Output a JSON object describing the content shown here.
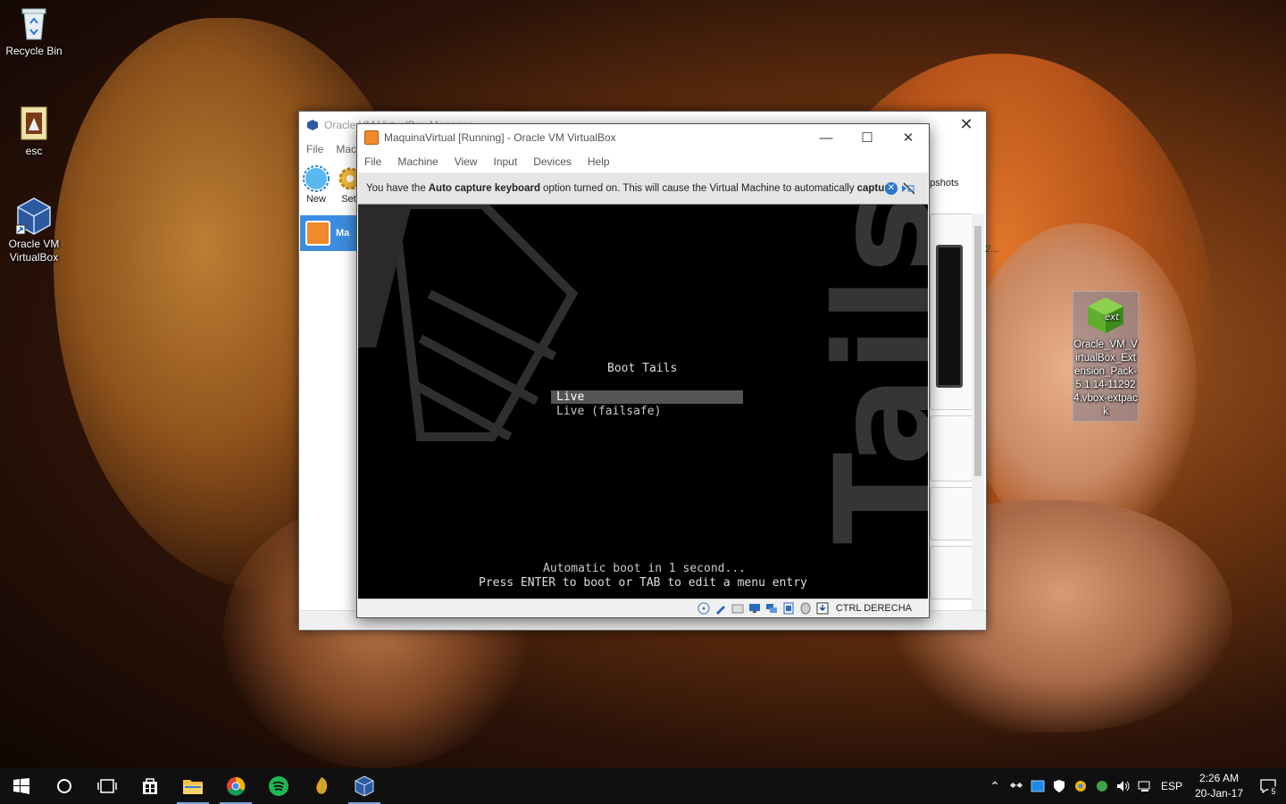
{
  "desktop": {
    "icons": [
      {
        "label": "Recycle Bin",
        "icon": "recycle-bin-icon"
      },
      {
        "label": "esc",
        "icon": "folder-icon"
      },
      {
        "label": "Oracle VM VirtualBox",
        "icon": "virtualbox-icon"
      }
    ],
    "ext_file": {
      "label": "Oracle_VM_VirtualBox_Extension_Pack-5.1.14-112924.vbox-extpack",
      "icon": "ext-cube-icon",
      "badge": "ext"
    }
  },
  "manager": {
    "title": "Oracle VM VirtualBox Manager",
    "menu": [
      "File",
      "Mac"
    ],
    "toolbar": {
      "new_label": "New",
      "settings_label": "Sett"
    },
    "vm_item_label": "Ma",
    "snapshots_label": "apshots",
    "preview_truncated": "2..."
  },
  "vm_window": {
    "title": "MaquinaVirtual [Running] - Oracle VM VirtualBox",
    "menu": [
      "File",
      "Machine",
      "View",
      "Input",
      "Devices",
      "Help"
    ],
    "notice": {
      "prefix": "You have the",
      "bold1": "Auto capture keyboard",
      "middle": "option turned on. This will cause the Virtual Machine to automatically",
      "bold2": "capture"
    },
    "screen": {
      "brand_text": "Tails",
      "menu_title": "Boot Tails",
      "entries": [
        "Live",
        "Live (failsafe)"
      ],
      "selected_index": 0,
      "footer_line1": "Automatic boot in 1 second...",
      "footer_line2": "Press ENTER to boot or TAB to edit a menu entry"
    },
    "status": {
      "host_key": "CTRL DERECHA"
    }
  },
  "taskbar": {
    "apps": [
      "start-icon",
      "cortana-icon",
      "task-view-icon",
      "store-icon",
      "file-explorer-icon",
      "chrome-icon",
      "spotify-icon",
      "fl-studio-icon",
      "virtualbox-icon"
    ],
    "tray": {
      "language": "ESP",
      "time": "2:26 AM",
      "date": "20-Jan-17",
      "notifications": "5"
    }
  },
  "colors": {
    "accent": "#3d8ce0",
    "taskbar": "#101010"
  }
}
